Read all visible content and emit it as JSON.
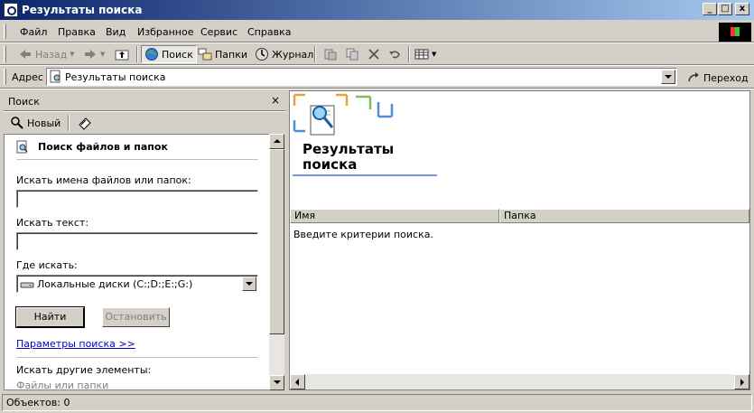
{
  "window": {
    "title": "Результаты поиска"
  },
  "window_controls": {
    "minimize": "_",
    "maximize": "□",
    "close": "x"
  },
  "menu": [
    "Файл",
    "Правка",
    "Вид",
    "Избранное",
    "Сервис",
    "Справка"
  ],
  "toolbar": {
    "back": "Назад",
    "search": "Поиск",
    "folders": "Папки",
    "history": "Журнал"
  },
  "address": {
    "label": "Адрес",
    "value": "Результаты поиска",
    "go": "Переход"
  },
  "search_pane": {
    "title": "Поиск",
    "close": "×",
    "new_button": "Новый",
    "heading": "Поиск файлов и папок",
    "name_label": "Искать имена файлов или папок:",
    "name_value": "",
    "text_label": "Искать текст:",
    "text_value": "",
    "where_label": "Где искать:",
    "where_value": "Локальные диски (C:;D:;E:;G:)",
    "find_button": "Найти",
    "stop_button": "Остановить",
    "options_link": "Параметры поиска >>",
    "other_label": "Искать другие элементы:",
    "other_item": "Файлы или папки"
  },
  "results": {
    "title_line1": "Результаты",
    "title_line2": "поиска",
    "col_name": "Имя",
    "col_folder": "Папка",
    "message": "Введите критерии поиска."
  },
  "status": {
    "objects": "Объектов: 0"
  },
  "colors": {
    "titlebar": "#0a246a",
    "link": "#0000cc",
    "accent_underline": "#7a96df"
  }
}
